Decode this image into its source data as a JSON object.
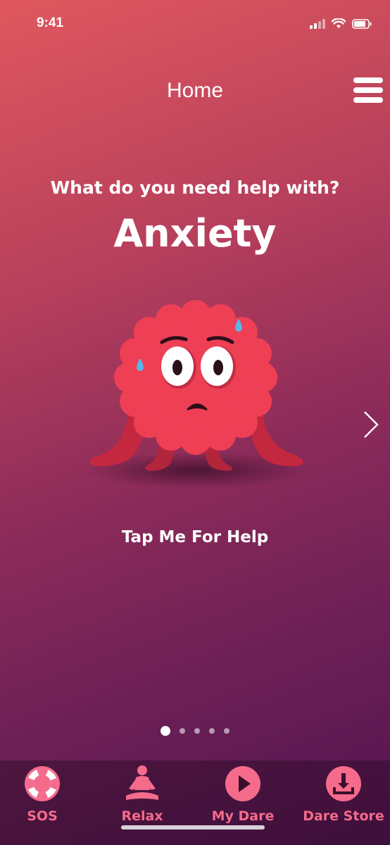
{
  "status_bar": {
    "time": "9:41"
  },
  "header": {
    "title": "Home"
  },
  "main": {
    "question": "What do you need help with?",
    "topic": "Anxiety",
    "tap_label": "Tap Me For Help",
    "pager": {
      "count": 5,
      "active": 1
    }
  },
  "tabs": [
    {
      "label": "SOS",
      "icon": "lifebuoy-icon"
    },
    {
      "label": "Relax",
      "icon": "meditation-icon"
    },
    {
      "label": "My Dare",
      "icon": "play-icon"
    },
    {
      "label": "Dare Store",
      "icon": "download-icon"
    }
  ],
  "colors": {
    "accent": "#f56b8c",
    "mascot": "#ee3f55",
    "gradient_top": "#e0585e",
    "gradient_bottom": "#521350"
  }
}
